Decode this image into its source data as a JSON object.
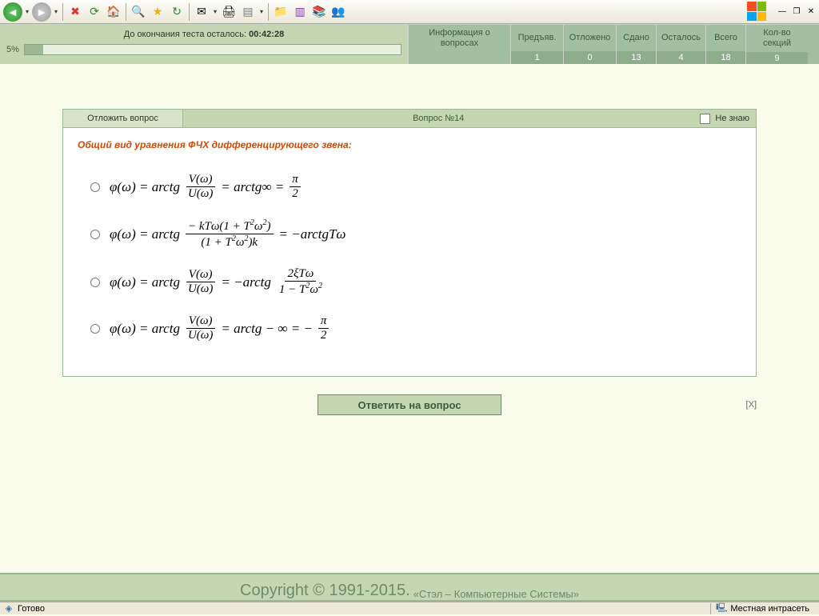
{
  "timer": {
    "label": "До окончания теста осталось:",
    "value": "00:42:28"
  },
  "progress": {
    "percent_label": "5%",
    "percent": 5
  },
  "infocols": {
    "about": "Информация о вопросах",
    "c1": {
      "h": "Предъяв.",
      "v": "1"
    },
    "c2": {
      "h": "Отложено",
      "v": "0"
    },
    "c3": {
      "h": "Сдано",
      "v": "13"
    },
    "c4": {
      "h": "Осталось",
      "v": "4"
    },
    "c5": {
      "h": "Всего",
      "v": "18"
    },
    "c6": {
      "h": "Кол-во секций",
      "v": "9"
    }
  },
  "question": {
    "postpone": "Отложить вопрос",
    "number_label": "Вопрос  №14",
    "dont_know": "Не знаю",
    "prompt": "Общий вид уравнения ФЧХ дифференцирующего звена:",
    "options": [
      "φ(ω) = arctg V(ω)/U(ω) = arctg∞ = π/2",
      "φ(ω) = arctg (−kTω(1+T²ω²)) / ((1+T²ω²)k) = −arctgTω",
      "φ(ω) = arctg V(ω)/U(ω) = −arctg (2ξTω)/(1−T²ω²)",
      "φ(ω) = arctg V(ω)/U(ω) = arctg −∞ = −π/2"
    ]
  },
  "submit_label": "Ответить на вопрос",
  "x_label": "[X]",
  "copyright": {
    "big": "Copyright  © 1991-2015.",
    "small": "«Стэл – Компьютерные Системы»"
  },
  "status": {
    "ready": "Готово",
    "zone": "Местная интрасеть"
  }
}
